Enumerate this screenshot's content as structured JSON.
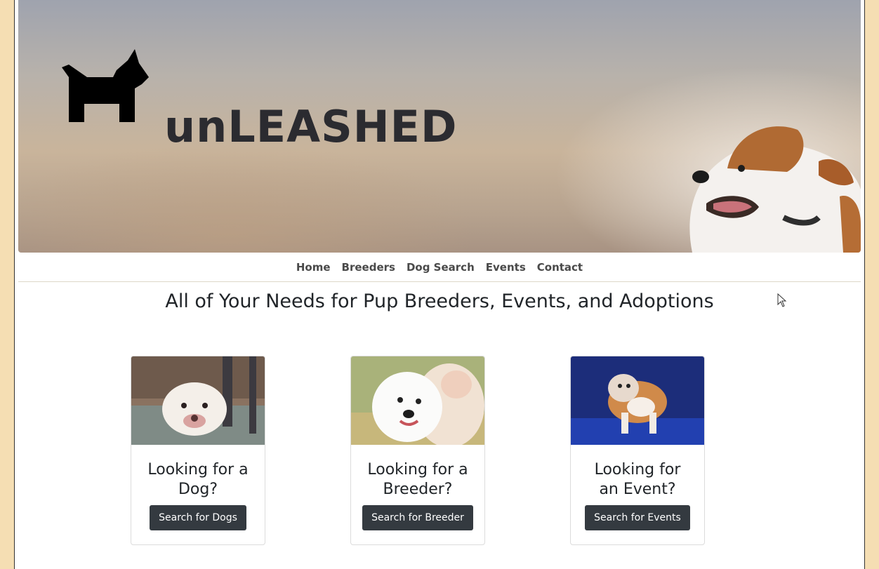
{
  "hero": {
    "title": "unLEASHED",
    "brand_icon": "dog-icon"
  },
  "nav": {
    "items": [
      {
        "label": "Home"
      },
      {
        "label": "Breeders"
      },
      {
        "label": "Dog Search"
      },
      {
        "label": "Events"
      },
      {
        "label": "Contact"
      }
    ]
  },
  "main": {
    "headline": "All of Your Needs for Pup Breeders, Events, and Adoptions",
    "cards": [
      {
        "title_line1": "Looking for a",
        "title_line2": "Dog?",
        "button_label": "Search for Dogs",
        "image": "pitbull-photo"
      },
      {
        "title_line1": "Looking for a",
        "title_line2": "Breeder?",
        "button_label": "Search for Breeder",
        "image": "samoyed-photo"
      },
      {
        "title_line1": "Looking for",
        "title_line2": "an Event?",
        "button_label": "Search for Events",
        "image": "bulldog-show-photo"
      }
    ]
  },
  "colors": {
    "page_background": "#f5deb3",
    "button_background": "#343a40",
    "text_dark": "#212529"
  }
}
